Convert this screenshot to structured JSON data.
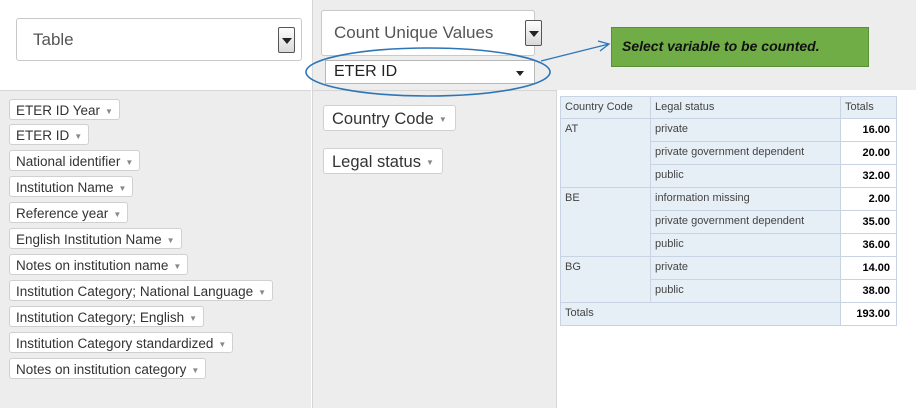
{
  "renderer": {
    "selected": "Table"
  },
  "aggregator": {
    "selected": "Count Unique Values",
    "attribute": "ETER ID"
  },
  "unused_attributes": [
    "ETER ID Year",
    "ETER ID",
    "National identifier",
    "Institution Name",
    "Reference year",
    "English Institution Name",
    "Notes on institution name",
    "Institution Category; National Language",
    "Institution Category; English",
    "Institution Category standardized",
    "Notes on institution category"
  ],
  "row_attributes": [
    "Country Code",
    "Legal status"
  ],
  "table": {
    "headers": [
      "Country Code",
      "Legal status",
      "Totals"
    ],
    "groups": [
      {
        "country": "AT",
        "rows": [
          {
            "status": "private",
            "value": "16.00"
          },
          {
            "status": "private government dependent",
            "value": "20.00"
          },
          {
            "status": "public",
            "value": "32.00"
          }
        ]
      },
      {
        "country": "BE",
        "rows": [
          {
            "status": "information missing",
            "value": "2.00"
          },
          {
            "status": "private government dependent",
            "value": "35.00"
          },
          {
            "status": "public",
            "value": "36.00"
          }
        ]
      },
      {
        "country": "BG",
        "rows": [
          {
            "status": "private",
            "value": "14.00"
          },
          {
            "status": "public",
            "value": "38.00"
          }
        ]
      }
    ],
    "totals_label": "Totals",
    "grand_total": "193.00"
  },
  "annotation": {
    "text": "Select variable to be counted.",
    "color": "#70ad47",
    "ellipse_color": "#2e75b6"
  },
  "icons": {
    "dropdown": "triangle-down-icon"
  }
}
